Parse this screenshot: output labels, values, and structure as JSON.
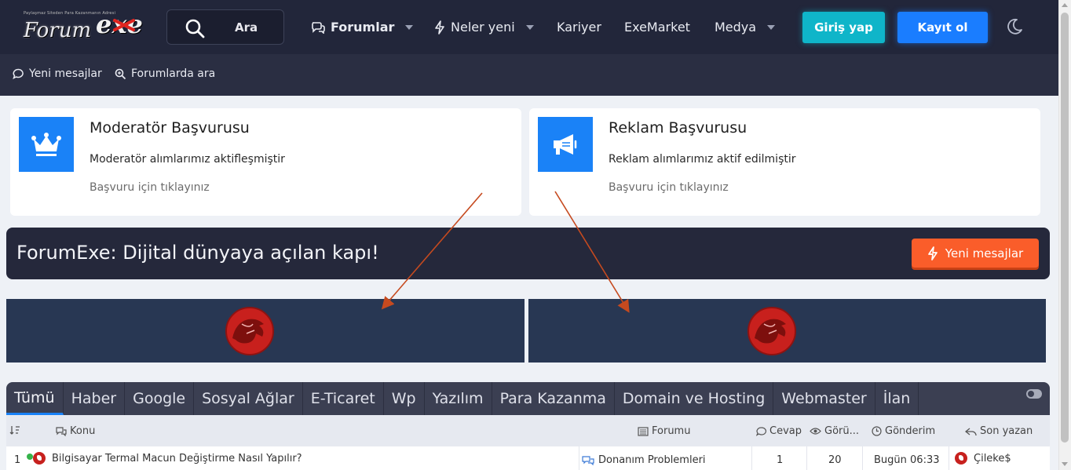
{
  "header": {
    "logo_tagline": "Paylaşmaz Siteden Para Kazanmanın Adresi",
    "logo_forum": "Forum",
    "logo_exe": "exe",
    "search_label": "Ara",
    "nav": [
      {
        "label": "Forumlar",
        "icon": "chat-bubbles-icon",
        "dropdown": true
      },
      {
        "label": "Neler yeni",
        "icon": "lightning-icon",
        "dropdown": true
      },
      {
        "label": "Kariyer",
        "dropdown": false
      },
      {
        "label": "ExeMarket",
        "dropdown": false
      },
      {
        "label": "Medya",
        "dropdown": true
      }
    ],
    "login_label": "Giriş yap",
    "register_label": "Kayıt ol",
    "theme_icon": "moon-icon"
  },
  "subbar": {
    "new_messages": "Yeni mesajlar",
    "search_forums": "Forumlarda ara"
  },
  "cards": [
    {
      "title": "Moderatör Başvurusu",
      "description": "Moderatör alımlarımız aktifleşmiştir",
      "cta": "Başvuru için tıklayınız",
      "icon": "crown-icon"
    },
    {
      "title": "Reklam Başvurusu",
      "description": "Reklam alımlarımız aktif edilmiştir",
      "cta": "Başvuru için tıklayınız",
      "icon": "megaphone-icon"
    }
  ],
  "banner": {
    "text": "ForumExe: Dijital dünyaya açılan kapı!",
    "button_label": "Yeni mesajlar"
  },
  "tabs": [
    "Tümü",
    "Haber",
    "Google",
    "Sosyal Ağlar",
    "E-Ticaret",
    "Wp",
    "Yazılım",
    "Para Kazanma",
    "Domain ve Hosting",
    "Webmaster",
    "İlan"
  ],
  "table": {
    "headers": {
      "topic": "Konu",
      "forum": "Forumu",
      "replies": "Cevap",
      "views": "Görü...",
      "posted": "Gönderim",
      "last_poster": "Son yazan"
    },
    "rows": [
      {
        "index": "1",
        "topic": "Bilgisayar Termal Macun Değiştirme Nasıl Yapılır?",
        "forum": "Donanım Problemleri",
        "replies": "1",
        "views": "20",
        "posted": "Bugün 06:33",
        "last_poster": "Çileke$"
      }
    ]
  },
  "colors": {
    "header_bg": "#22263a",
    "accent_blue": "#1a82f7",
    "login_cyan": "#0fb5c9",
    "orange": "#fa5d2a"
  }
}
